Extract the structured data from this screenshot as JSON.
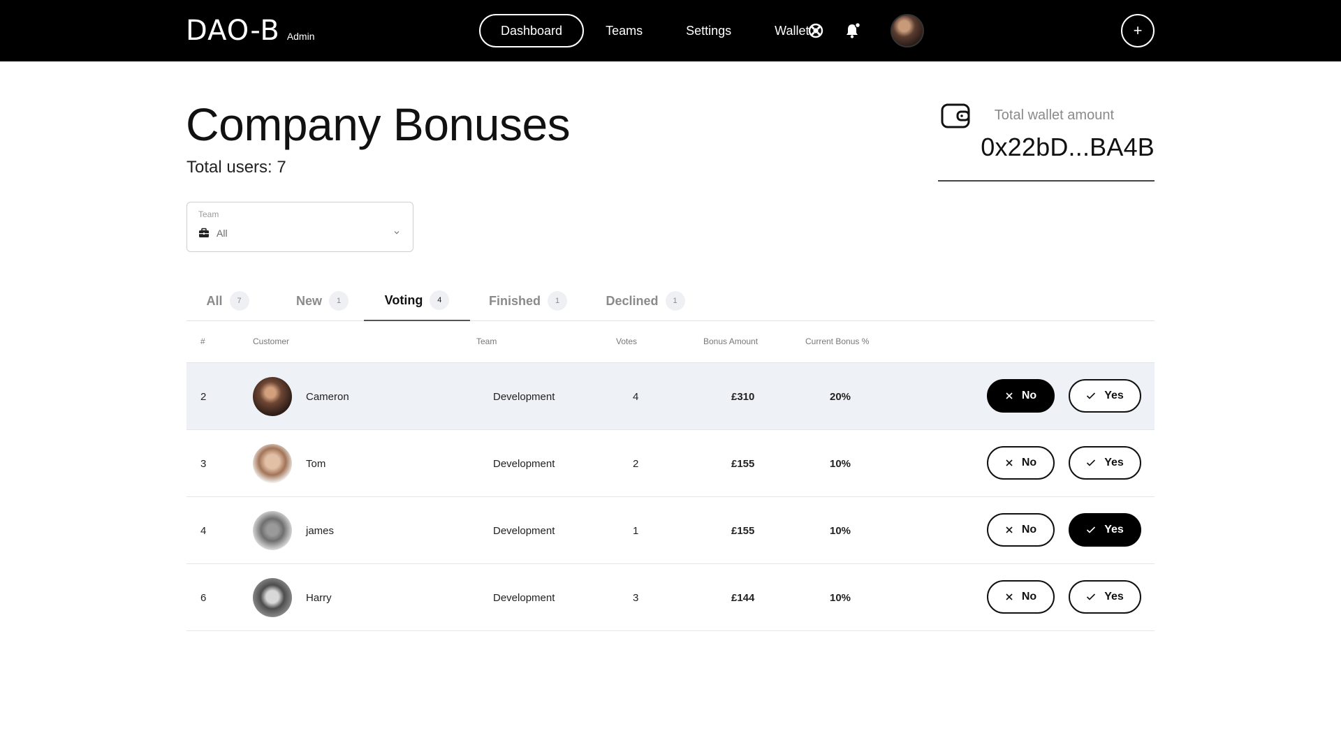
{
  "app": {
    "logo": "DAO-B",
    "role": "Admin"
  },
  "nav": {
    "items": [
      {
        "label": "Dashboard",
        "active": true
      },
      {
        "label": "Teams",
        "active": false
      },
      {
        "label": "Settings",
        "active": false
      },
      {
        "label": "Wallet",
        "active": false
      }
    ]
  },
  "top_actions": {
    "plus_label": "+",
    "icons": [
      "help-icon",
      "bell-icon",
      "user-avatar",
      "plus-icon"
    ]
  },
  "page": {
    "title": "Company Bonuses",
    "total_users": "Total users: 7"
  },
  "wallet": {
    "label": "Total wallet amount",
    "value": "0x22bD...BA4B"
  },
  "team_filter": {
    "label": "Team",
    "value": "All"
  },
  "tabs": [
    {
      "label": "All",
      "count": "7",
      "active": false
    },
    {
      "label": "New",
      "count": "1",
      "active": false
    },
    {
      "label": "Voting",
      "count": "4",
      "active": true
    },
    {
      "label": "Finished",
      "count": "1",
      "active": false
    },
    {
      "label": "Declined",
      "count": "1",
      "active": false
    }
  ],
  "table": {
    "headers": [
      "#",
      "Customer",
      "Team",
      "Votes",
      "Bonus Amount",
      "Current Bonus %"
    ],
    "rows": [
      {
        "num": "2",
        "name": "Cameron",
        "team": "Development",
        "votes": "4",
        "amount": "£310",
        "pct": "20%",
        "no_label": "No",
        "yes_label": "Yes",
        "selected": "no"
      },
      {
        "num": "3",
        "name": "Tom",
        "team": "Development",
        "votes": "2",
        "amount": "£155",
        "pct": "10%",
        "no_label": "No",
        "yes_label": "Yes",
        "selected": "none"
      },
      {
        "num": "4",
        "name": "james",
        "team": "Development",
        "votes": "1",
        "amount": "£155",
        "pct": "10%",
        "no_label": "No",
        "yes_label": "Yes",
        "selected": "yes"
      },
      {
        "num": "6",
        "name": "Harry",
        "team": "Development",
        "votes": "3",
        "amount": "£144",
        "pct": "10%",
        "no_label": "No",
        "yes_label": "Yes",
        "selected": "none"
      }
    ]
  },
  "colors": {
    "topbar": "#000000",
    "highlight_row": "#eef2f6",
    "badge_bg": "#eef0f3"
  }
}
